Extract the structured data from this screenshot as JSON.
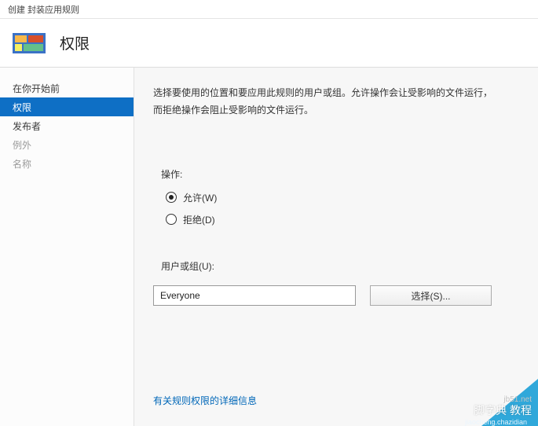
{
  "window_title": "创建 封装应用规则",
  "page_title": "权限",
  "sidebar": {
    "items": [
      {
        "label": "在你开始前",
        "selected": false,
        "disabled": false
      },
      {
        "label": "权限",
        "selected": true,
        "disabled": false
      },
      {
        "label": "发布者",
        "selected": false,
        "disabled": false
      },
      {
        "label": "例外",
        "selected": false,
        "disabled": true
      },
      {
        "label": "名称",
        "selected": false,
        "disabled": true
      }
    ]
  },
  "content": {
    "description_line1": "选择要使用的位置和要应用此规则的用户或组。允许操作会让受影响的文件运行，",
    "description_line2": "而拒绝操作会阻止受影响的文件运行。",
    "action_label": "操作:",
    "radio_allow": "允许(W)",
    "radio_deny": "拒绝(D)",
    "usergroup_label": "用户或组(U):",
    "usergroup_value": "Everyone",
    "select_button": "选择(S)...",
    "footer_link": "有关规则权限的详细信息"
  },
  "watermark": {
    "small": "jb51.net",
    "main": "脚字典 教程",
    "sub": "jiaocheng.chazidian"
  }
}
